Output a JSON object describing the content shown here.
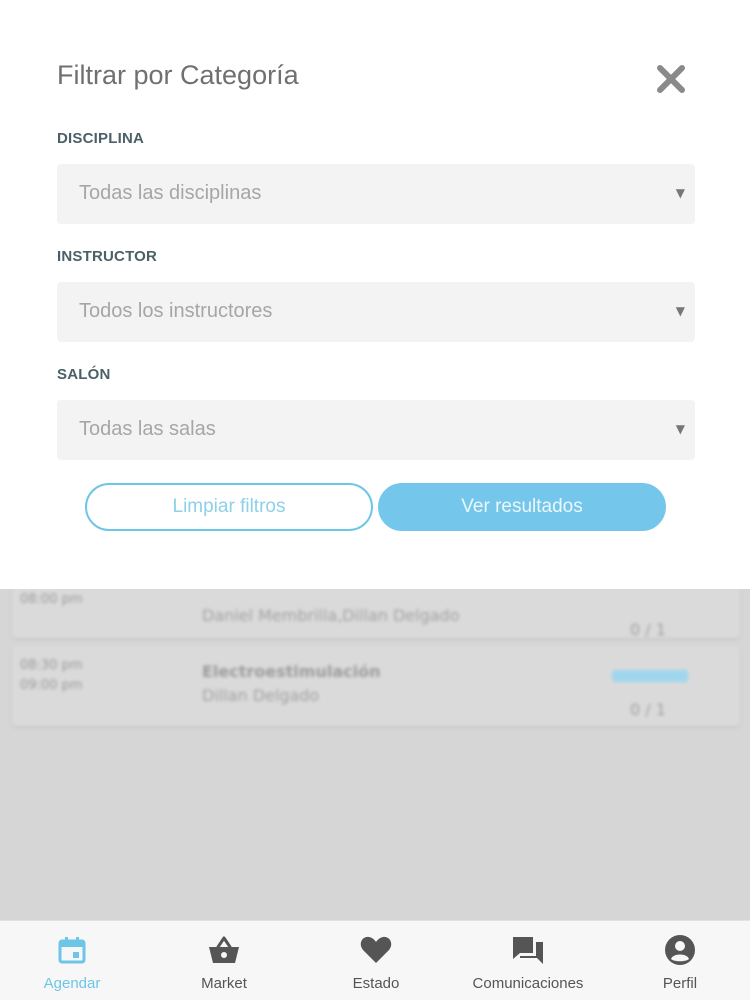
{
  "modal": {
    "title": "Filtrar por Categoría",
    "fields": [
      {
        "label": "DISCIPLINA",
        "value": "Todas las disciplinas"
      },
      {
        "label": "INSTRUCTOR",
        "value": "Todos los instructores"
      },
      {
        "label": "SALÓN",
        "value": "Todas las salas"
      }
    ],
    "clear_label": "Limpiar filtros",
    "results_label": "Ver resultados"
  },
  "background_list": [
    {
      "time_start": "08:00 pm",
      "time_end": "",
      "class_name": "",
      "instructor": "Daniel Membrilla,Dillan Delgado",
      "slots": "0 / 1"
    },
    {
      "time_start": "08:30 pm",
      "time_end": "09:00 pm",
      "class_name": "Electroestimulación",
      "instructor": "Dillan Delgado",
      "slots": "0 / 1"
    }
  ],
  "nav": [
    {
      "label": "Agendar",
      "icon": "calendar-icon",
      "active": true
    },
    {
      "label": "Market",
      "icon": "basket-icon",
      "active": false
    },
    {
      "label": "Estado",
      "icon": "heart-icon",
      "active": false
    },
    {
      "label": "Comunicaciones",
      "icon": "chat-icon",
      "active": false
    },
    {
      "label": "Perfil",
      "icon": "profile-icon",
      "active": false
    }
  ],
  "colors": {
    "accent": "#6ec6e6",
    "label": "#4b6068",
    "overlay": "#d6d6d6"
  }
}
